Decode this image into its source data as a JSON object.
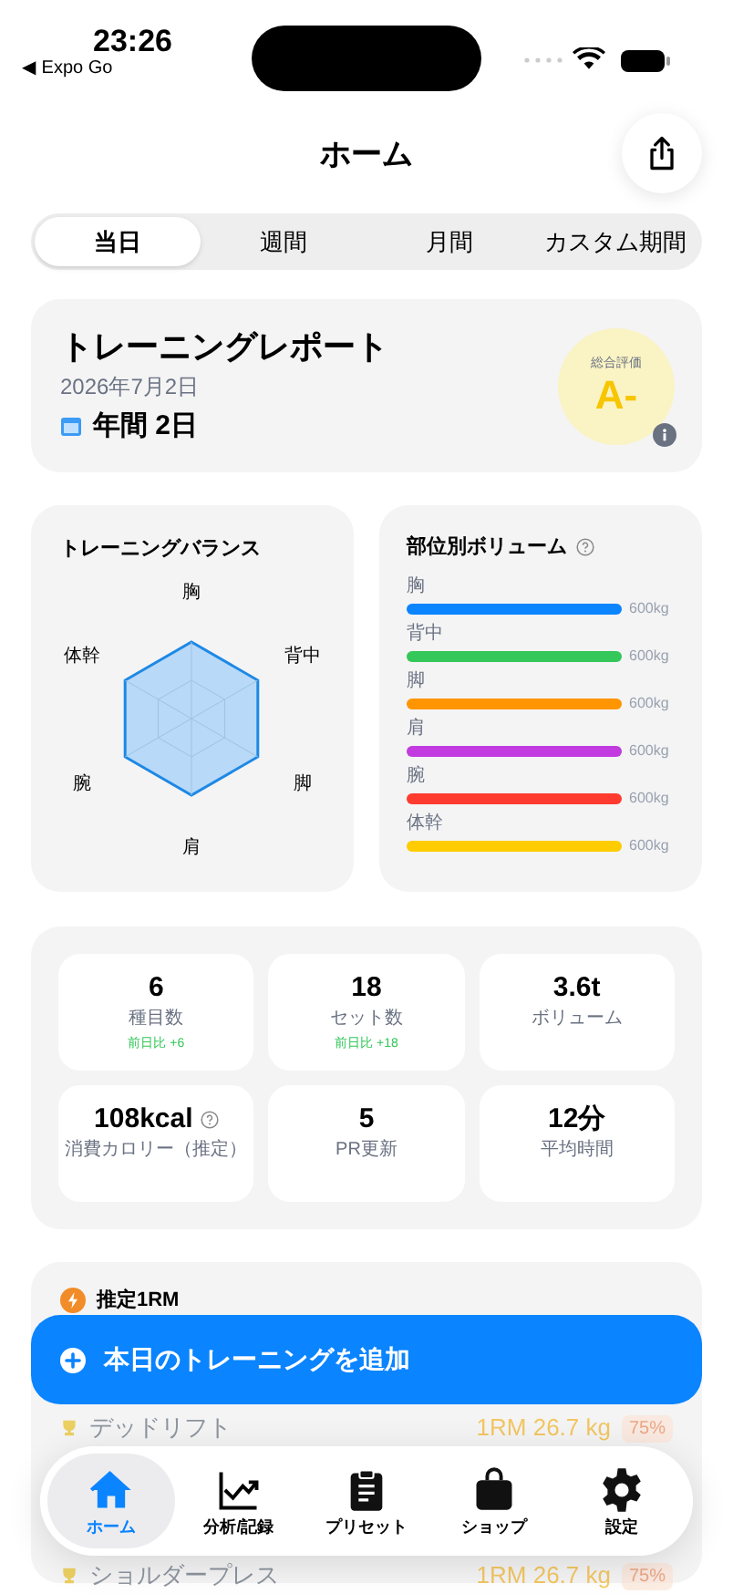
{
  "status_bar": {
    "time": "23:26",
    "back_label": "◀ Expo Go"
  },
  "header": {
    "title": "ホーム"
  },
  "tabs": [
    {
      "label": "当日",
      "selected": true
    },
    {
      "label": "週間",
      "selected": false
    },
    {
      "label": "月間",
      "selected": false
    },
    {
      "label": "カスタム期間",
      "selected": false
    }
  ],
  "report": {
    "title": "トレーニングレポート",
    "date": "2026年7月2日",
    "period": "年間 2日",
    "grade_label": "総合評価",
    "grade": "A-"
  },
  "balance": {
    "title": "トレーニングバランス",
    "axes": [
      "胸",
      "背中",
      "脚",
      "肩",
      "腕",
      "体幹"
    ]
  },
  "volume": {
    "title": "部位別ボリューム",
    "parts": [
      {
        "label": "胸",
        "color": "#0a84ff",
        "level": 1,
        "reading": "600kg"
      },
      {
        "label": "背中",
        "color": "#34c759",
        "level": 1,
        "reading": "600kg"
      },
      {
        "label": "脚",
        "color": "#ff9500",
        "level": 1,
        "reading": "600kg"
      },
      {
        "label": "肩",
        "color": "#c13be0",
        "level": 1,
        "reading": "600kg"
      },
      {
        "label": "腕",
        "color": "#ff3b30",
        "level": 1,
        "reading": "600kg"
      },
      {
        "label": "体幹",
        "color": "#ffcc00",
        "level": 1,
        "reading": "600kg"
      }
    ]
  },
  "stats": [
    {
      "value": "6",
      "label": "種目数",
      "change": "前日比 +6",
      "help": false
    },
    {
      "value": "18",
      "label": "セット数",
      "change": "前日比 +18",
      "help": false
    },
    {
      "value": "3.6t",
      "label": "ボリューム",
      "help": false
    },
    {
      "value": "108kcal",
      "label": "消費カロリー（推定）",
      "help": true
    },
    {
      "value": "5",
      "label": "PR更新",
      "help": false
    },
    {
      "value": "12分",
      "label": "平均時間",
      "help": false
    }
  ],
  "one_rm": {
    "title": "推定1RM",
    "rows": [
      {
        "name": "デッドリフト",
        "value": "1RM 26.7 kg",
        "percent": "75%"
      },
      {
        "name": "ショルダープレス",
        "value": "1RM 26.7 kg",
        "percent": "75%"
      }
    ]
  },
  "add_button": {
    "label": "本日のトレーニングを追加"
  },
  "tab_bar": [
    {
      "kind": "home",
      "label": "ホーム",
      "selected": true
    },
    {
      "kind": "chart",
      "label": "分析/記録",
      "selected": false
    },
    {
      "kind": "clipboard",
      "label": "プリセット",
      "selected": false
    },
    {
      "kind": "bag",
      "label": "ショップ",
      "selected": false
    },
    {
      "kind": "gear",
      "label": "設定",
      "selected": false
    }
  ]
}
